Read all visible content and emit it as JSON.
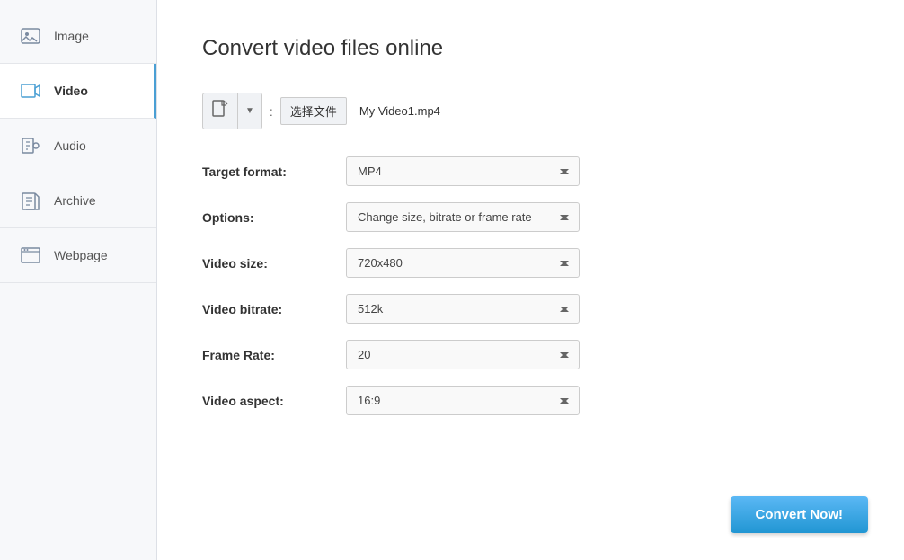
{
  "sidebar": {
    "items": [
      {
        "id": "image",
        "label": "Image",
        "active": false
      },
      {
        "id": "video",
        "label": "Video",
        "active": true
      },
      {
        "id": "audio",
        "label": "Audio",
        "active": false
      },
      {
        "id": "archive",
        "label": "Archive",
        "active": false
      },
      {
        "id": "webpage",
        "label": "Webpage",
        "active": false
      }
    ]
  },
  "main": {
    "title": "Convert video files online",
    "file_upload": {
      "choose_btn_label": "选择文件",
      "file_name": "My Video1.mp4",
      "colon": ":"
    },
    "form": {
      "target_format": {
        "label": "Target format:",
        "value": "MP4"
      },
      "options": {
        "label": "Options:",
        "value": "Change size, bitrate or frame rate"
      },
      "video_size": {
        "label": "Video size:",
        "value": "720x480"
      },
      "video_bitrate": {
        "label": "Video bitrate:",
        "value": "512k"
      },
      "frame_rate": {
        "label": "Frame Rate:",
        "value": "20"
      },
      "video_aspect": {
        "label": "Video aspect:",
        "value": "16:9"
      }
    },
    "convert_btn_label": "Convert Now!"
  }
}
